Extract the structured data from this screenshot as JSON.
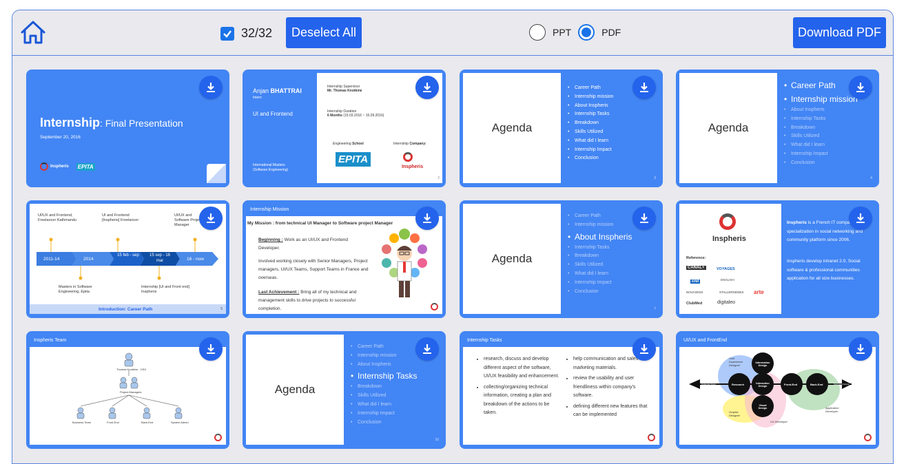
{
  "toolbar": {
    "selected_count": "32/32",
    "deselect_label": "Deselect All",
    "format_options": [
      "PPT",
      "PDF"
    ],
    "selected_format": "PDF",
    "download_label": "Download PDF"
  },
  "accent": "#2463eb",
  "card_color": "#4285f4",
  "slides": {
    "s1": {
      "title_bold": "Internship",
      "title_rest": ": Final Presentation",
      "date": "September 20, 2016",
      "logo1": "Inspheris",
      "logo2": "EPITA"
    },
    "s2": {
      "first_name": "Anjan",
      "last_name": "BHATTRAI",
      "role_small": "Intern",
      "role": "UI and Frontend",
      "program": "International Masters",
      "program2": "(Software Engineering)",
      "supervisor_label": "Internship Supervisor",
      "supervisor": "Mr. Thomas Knotkine",
      "duration_label": "Internship Duration",
      "duration": "6 Months",
      "duration_dates": "(15.03.2016 ~ 15.09.2016)",
      "school_label_a": "Engineering",
      "school_label_b": "School",
      "company_label_a": "Internship",
      "company_label_b": "Company:",
      "school_logo": "EPITA",
      "company_logo": "Inspheris",
      "page": "2"
    },
    "agenda_title": "Agenda",
    "agenda_items": [
      "Career Path",
      "Internship mission",
      "About Inspheris",
      "Internship Tasks",
      "Breakdown",
      "Skills Utilized",
      "What did I learn",
      "Internship Impact",
      "Conclusion"
    ],
    "s3_page": "3",
    "s4_page": "4",
    "s7_page": "7",
    "s10_page": "10",
    "s5": {
      "top1": "UI/UX and Frontend, Freelancer Kathmandu",
      "top2": "UI and Frontend [Inspheris] Freelancer",
      "top3": "UI/UX and Software Project Manager",
      "steps": [
        "2011-14",
        "2014",
        "15 feb - sep",
        "15 sep - 16 mar",
        "16 - now"
      ],
      "bottom1": "Masters in Software Engineering, Epita",
      "bottom2": "Internship [UI and Front end] Inspheris",
      "footer": "Introduction: Career Path",
      "page": "5"
    },
    "s6": {
      "header": "Internship Mission",
      "mission": "My Mission : from technical UI Manager to Software project Manager",
      "beginning_label": "Beginning :",
      "beginning": "Work as an UI/UX and Frontend Developer.",
      "involved": "Involved working closely with Senior Managers, Project managers, UI/UX Teams, Support Teams in France and overseas.",
      "last_label": "Last Achievement :",
      "last": "Bring all of my technical and management skills to drive projects to successful completion."
    },
    "s8": {
      "logo": "Inspheris",
      "reference": "Reference:",
      "refs": [
        "CANAL+",
        "VOYAGES",
        "cnil",
        "ENGLISH",
        "NOVAXESS",
        "STALLERGENES",
        "arte",
        "ClubMed",
        "digitaleo"
      ],
      "p1_bold": "Inspheris",
      "p1": "is a French IT company with specialization in social networking and community platform since 2006.",
      "p2": "Inspheris develop intranet 2.0, Social software & professional communities application for all size businesses."
    },
    "s9": {
      "header": "Inspheris Team",
      "ceo": "Thomas Knotkine - CEO",
      "pm": "Project Managers",
      "teams": [
        "Business Team",
        "Front-End",
        "Back-End",
        "System Admin"
      ]
    },
    "s11": {
      "header": "Internship Tasks",
      "left": [
        "research, discuss and develop different aspect of the software, UI/UX feasibility and enhancement.",
        "collecting/organizing technical information, creating a plan and breakdown of the actions to be taken."
      ],
      "right": [
        "help communication and sales with marketing materials.",
        "review the usability and user friendliness within company's software.",
        "defining different new features that can be implemented"
      ]
    },
    "s12": {
      "header": "UI/UX and FrontEnd",
      "nodes": [
        "Information Design",
        "Research",
        "Interaction Design",
        "Front-End",
        "Back-End",
        "Visual Design"
      ],
      "roles": [
        "User Experience Designer",
        "Application Developer",
        "Graphic Designer",
        "UX Developer"
      ],
      "ends": [
        "Customer Input",
        "Technical Output"
      ]
    }
  }
}
